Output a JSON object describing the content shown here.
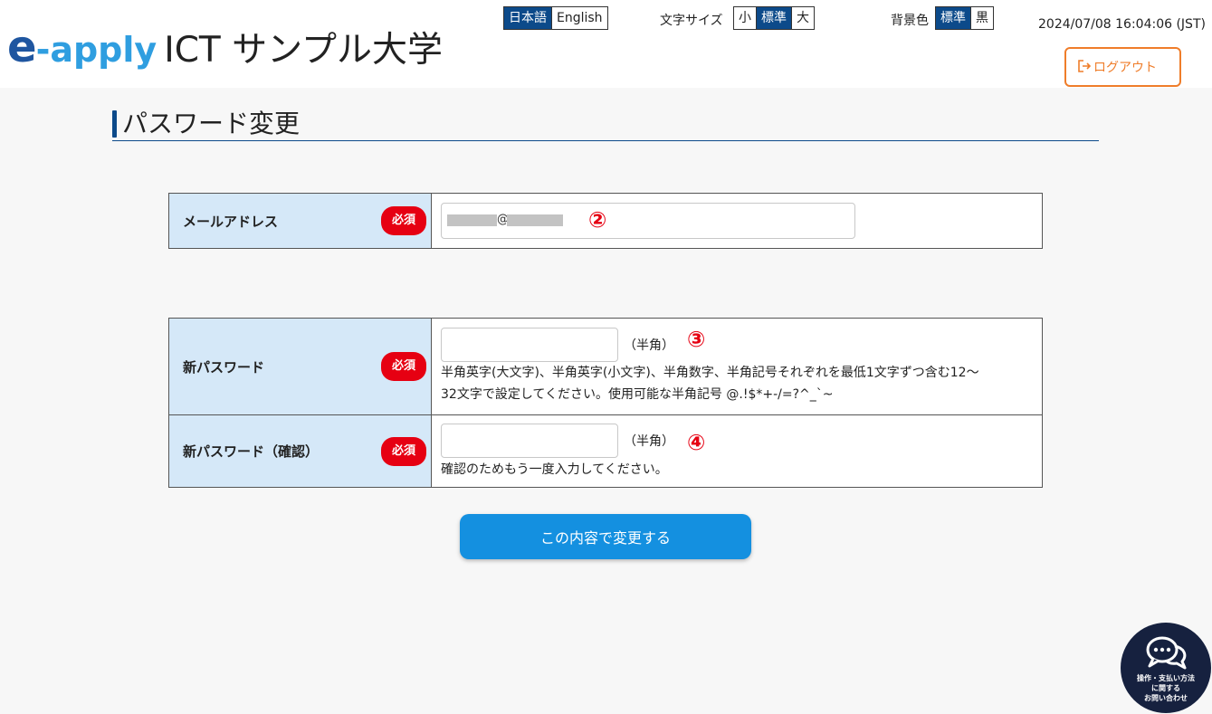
{
  "header": {
    "logo_e": "e",
    "logo_apply": "-apply",
    "university": "ICT サンプル大学",
    "language": {
      "options": [
        "日本語",
        "English"
      ],
      "active": 0
    },
    "font_size": {
      "label": "文字サイズ",
      "options": [
        "小",
        "標準",
        "大"
      ],
      "active": 1
    },
    "bg_color": {
      "label": "背景色",
      "options": [
        "標準",
        "黒"
      ],
      "active": 0
    },
    "datetime": "2024/07/08 16:04:06 (JST)",
    "logout_label": "ログアウト"
  },
  "page": {
    "title": "パスワード変更"
  },
  "email_section": {
    "label": "メールアドレス",
    "required": "必須",
    "value_at": "@",
    "annotation": "②"
  },
  "password_section": {
    "new_password": {
      "label": "新パスワード",
      "required": "必須",
      "unit": "（半角）",
      "annotation": "③",
      "hint_line1": "半角英字(大文字)、半角英字(小文字)、半角数字、半角記号それぞれを最低1文字ずつ含む12～",
      "hint_line2": "32文字で設定してください。使用可能な半角記号 @.!$*+-/=?^_`~"
    },
    "confirm_password": {
      "label": "新パスワード（確認）",
      "required": "必須",
      "unit": "（半角）",
      "annotation": "④",
      "hint": "確認のためもう一度入力してください。"
    }
  },
  "submit_label": "この内容で変更する",
  "help": {
    "line1": "操作・支払い方法",
    "line2": "に関する",
    "line3": "お問い合わせ"
  },
  "colors": {
    "primary_navy": "#0c4a8a",
    "accent_blue": "#1490e0",
    "required_red": "#e60012",
    "logout_orange": "#ef7d2a",
    "label_bg": "#d5e8f8"
  }
}
